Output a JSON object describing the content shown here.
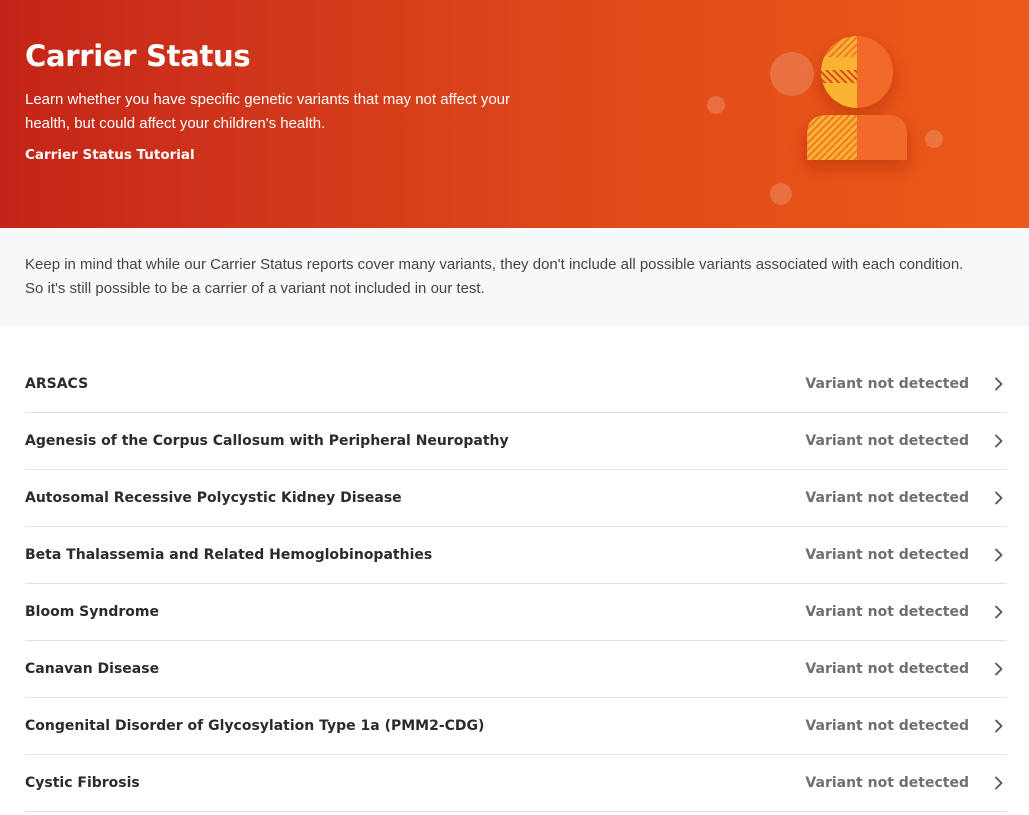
{
  "hero": {
    "title": "Carrier Status",
    "description": "Learn whether you have specific genetic variants that may not affect your health, but could affect your children's health.",
    "tutorial_link": "Carrier Status Tutorial"
  },
  "notice": {
    "text": "Keep in mind that while our Carrier Status reports cover many variants, they don't include all possible variants associated with each condition. So it's still possible to be a carrier of a variant not included in our test."
  },
  "colors": {
    "hero_start": "#c42418",
    "hero_end": "#ec5a17",
    "accent_yellow": "#f9b233",
    "accent_orange": "#f26b2a"
  },
  "conditions": [
    {
      "name": "ARSACS",
      "status": "Variant not detected"
    },
    {
      "name": "Agenesis of the Corpus Callosum with Peripheral Neuropathy",
      "status": "Variant not detected"
    },
    {
      "name": "Autosomal Recessive Polycystic Kidney Disease",
      "status": "Variant not detected"
    },
    {
      "name": "Beta Thalassemia and Related Hemoglobinopathies",
      "status": "Variant not detected"
    },
    {
      "name": "Bloom Syndrome",
      "status": "Variant not detected"
    },
    {
      "name": "Canavan Disease",
      "status": "Variant not detected"
    },
    {
      "name": "Congenital Disorder of Glycosylation Type 1a (PMM2-CDG)",
      "status": "Variant not detected"
    },
    {
      "name": "Cystic Fibrosis",
      "status": "Variant not detected"
    }
  ],
  "icons": {
    "row_chevron": "chevron-right-icon",
    "hero_illustration": "carrier-person-icon"
  }
}
